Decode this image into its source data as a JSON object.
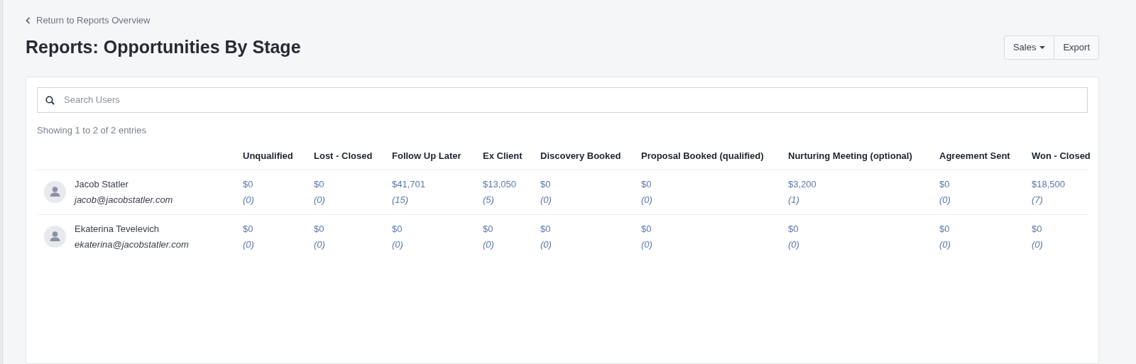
{
  "back_link": "Return to Reports Overview",
  "title": "Reports: Opportunities By Stage",
  "toolbar": {
    "dropdown": "Sales",
    "export": "Export"
  },
  "search": {
    "placeholder": "Search Users"
  },
  "entries_info": "Showing 1 to 2 of 2 entries",
  "table": {
    "columns": [
      "Unqualified",
      "Lost - Closed",
      "Follow Up Later",
      "Ex Client",
      "Discovery Booked",
      "Proposal Booked (qualified)",
      "Nurturing Meeting (optional)",
      "Agreement Sent",
      "Won - Closed"
    ],
    "rows": [
      {
        "name": "Jacob Statler",
        "email": "jacob@jacobstatler.com",
        "cells": [
          {
            "amount": "$0",
            "count": "(0)"
          },
          {
            "amount": "$0",
            "count": "(0)"
          },
          {
            "amount": "$41,701",
            "count": "(15)"
          },
          {
            "amount": "$13,050",
            "count": "(5)"
          },
          {
            "amount": "$0",
            "count": "(0)"
          },
          {
            "amount": "$0",
            "count": "(0)"
          },
          {
            "amount": "$3,200",
            "count": "(1)"
          },
          {
            "amount": "$0",
            "count": "(0)"
          },
          {
            "amount": "$18,500",
            "count": "(7)"
          }
        ]
      },
      {
        "name": "Ekaterina Tevelevich",
        "email": "ekaterina@jacobstatler.com",
        "cells": [
          {
            "amount": "$0",
            "count": "(0)"
          },
          {
            "amount": "$0",
            "count": "(0)"
          },
          {
            "amount": "$0",
            "count": "(0)"
          },
          {
            "amount": "$0",
            "count": "(0)"
          },
          {
            "amount": "$0",
            "count": "(0)"
          },
          {
            "amount": "$0",
            "count": "(0)"
          },
          {
            "amount": "$0",
            "count": "(0)"
          },
          {
            "amount": "$0",
            "count": "(0)"
          },
          {
            "amount": "$0",
            "count": "(0)"
          }
        ]
      }
    ]
  }
}
